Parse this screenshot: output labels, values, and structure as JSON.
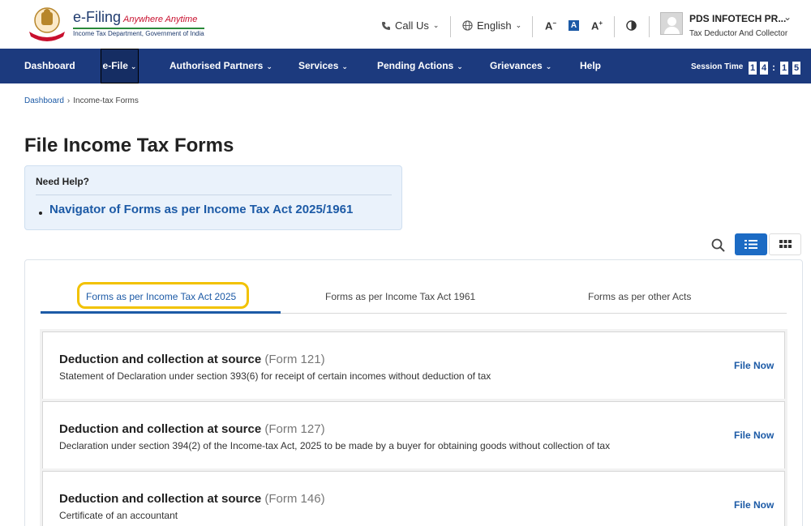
{
  "header": {
    "logo_title": "e-Filing",
    "logo_tagline": "Anywhere Anytime",
    "logo_subtitle": "Income Tax Department, Government of India",
    "call_us": "Call Us",
    "language": "English",
    "font_decrease": "A",
    "font_normal": "A",
    "font_increase": "A",
    "user_name": "PDS INFOTECH PR...",
    "user_role": "Tax Deductor And Collector"
  },
  "nav": {
    "items": [
      {
        "label": "Dashboard"
      },
      {
        "label": "e-File"
      },
      {
        "label": "Authorised Partners"
      },
      {
        "label": "Services"
      },
      {
        "label": "Pending Actions"
      },
      {
        "label": "Grievances"
      },
      {
        "label": "Help"
      }
    ],
    "session_label": "Session Time",
    "session_digits": [
      "1",
      "4",
      "1",
      "5"
    ]
  },
  "breadcrumb": {
    "home": "Dashboard",
    "current": "Income-tax Forms"
  },
  "page_title": "File Income Tax Forms",
  "help": {
    "title": "Need Help?",
    "link": "Navigator of Forms as per Income Tax Act 2025/1961"
  },
  "tabs": [
    {
      "label": "Forms as per Income Tax Act 2025",
      "active": true
    },
    {
      "label": "Forms as per Income Tax Act 1961",
      "active": false
    },
    {
      "label": "Forms as per other Acts",
      "active": false
    }
  ],
  "forms": [
    {
      "title": "Deduction and collection at source",
      "form": "(Form 121)",
      "description": "Statement of Declaration under section 393(6) for receipt of certain incomes without deduction of tax",
      "action": "File Now"
    },
    {
      "title": "Deduction and collection at source",
      "form": "(Form 127)",
      "description": "Declaration under section 394(2) of the Income-tax Act, 2025 to be made by a buyer for obtaining goods without collection of tax",
      "action": "File Now"
    },
    {
      "title": "Deduction and collection at source",
      "form": "(Form 146)",
      "description": "Certificate of an accountant",
      "action": "File Now"
    }
  ],
  "colors": {
    "nav_bg": "#1c3a7e",
    "link": "#1c5aa6",
    "highlight": "#f2c200"
  }
}
